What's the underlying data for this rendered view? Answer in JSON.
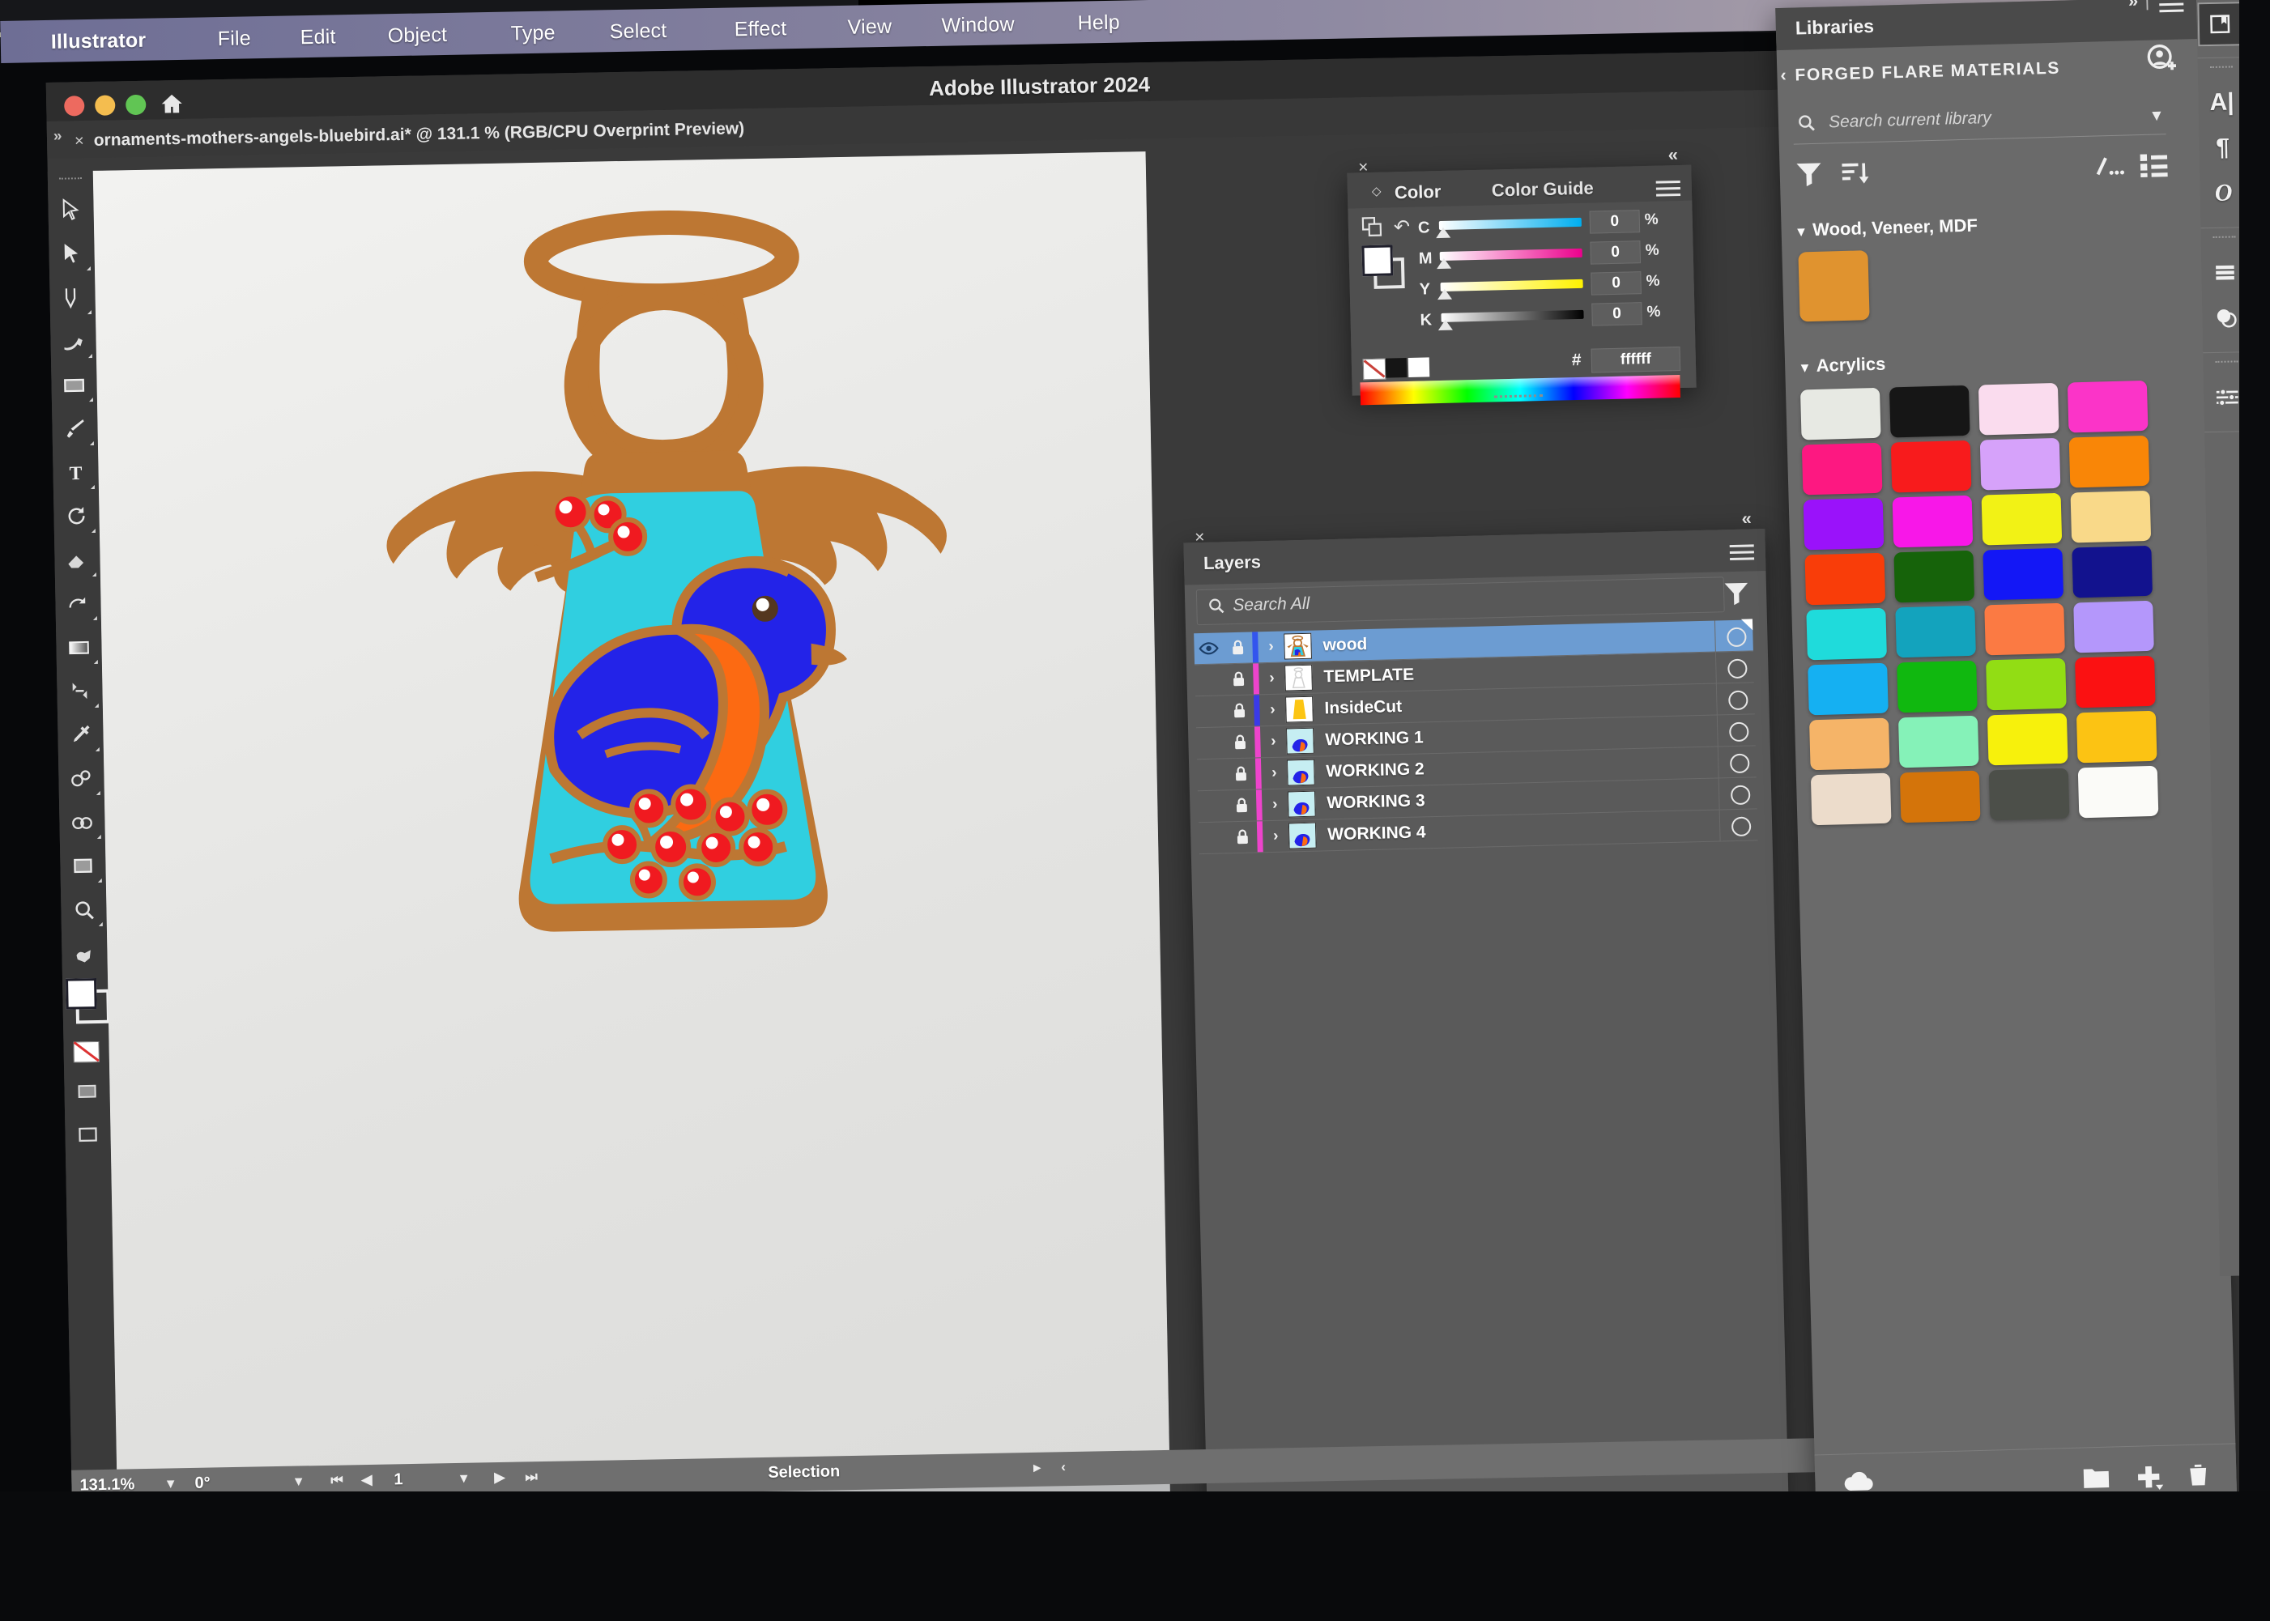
{
  "os_menu": {
    "items": [
      "Illustrator",
      "File",
      "Edit",
      "Object",
      "Type",
      "Select",
      "Effect",
      "View",
      "Window",
      "Help"
    ]
  },
  "app": {
    "title": "Adobe Illustrator 2024",
    "home_icon": "home-icon"
  },
  "document_tab": {
    "close_label": "×",
    "title": "ornaments-mothers-angels-bluebird.ai* @ 131.1 % (RGB/CPU Overprint Preview)"
  },
  "toolbar": {
    "tools": [
      {
        "name": "selection-tool",
        "glyph": "arrow"
      },
      {
        "name": "direct-selection-tool",
        "glyph": "arrow-filled"
      },
      {
        "name": "pen-tool",
        "glyph": "pen"
      },
      {
        "name": "curvature-tool",
        "glyph": "curvature"
      },
      {
        "name": "rectangle-tool",
        "glyph": "rect"
      },
      {
        "name": "paintbrush-tool",
        "glyph": "brush"
      },
      {
        "name": "type-tool",
        "glyph": "T"
      },
      {
        "name": "rotate-tool",
        "glyph": "rotate"
      },
      {
        "name": "eraser-tool",
        "glyph": "eraser"
      },
      {
        "name": "scale-tool",
        "glyph": "scale"
      },
      {
        "name": "gradient-tool",
        "glyph": "gradient"
      },
      {
        "name": "width-tool",
        "glyph": "width"
      },
      {
        "name": "eyedropper-tool",
        "glyph": "eyedropper"
      },
      {
        "name": "blend-tool",
        "glyph": "blend"
      },
      {
        "name": "shape-builder-tool",
        "glyph": "shapebuilder"
      },
      {
        "name": "artboard-tool",
        "glyph": "artboard"
      },
      {
        "name": "zoom-tool",
        "glyph": "zoom"
      },
      {
        "name": "hand-tool",
        "glyph": "hand"
      }
    ]
  },
  "color_panel": {
    "tabs": [
      {
        "label": "Color",
        "active": true
      },
      {
        "label": "Color Guide",
        "active": false
      }
    ],
    "sliders": [
      {
        "label": "C",
        "value": "0",
        "unit": "%",
        "track": "cyan"
      },
      {
        "label": "M",
        "value": "0",
        "unit": "%",
        "track": "magenta"
      },
      {
        "label": "Y",
        "value": "0",
        "unit": "%",
        "track": "yellow"
      },
      {
        "label": "K",
        "value": "0",
        "unit": "%",
        "track": "black"
      }
    ],
    "hex_symbol": "#",
    "hex_value": "ffffff",
    "fill_color": "#ffffff",
    "stroke_color": "#ffffff",
    "collapse_label": "«",
    "close_label": "×"
  },
  "layers_panel": {
    "tab_label": "Layers",
    "close_label": "×",
    "collapse_label": "«",
    "search_placeholder": "Search All",
    "search_value": "",
    "rows": [
      {
        "name": "wood",
        "visible": true,
        "locked": true,
        "selected": true,
        "color": "#3355ee",
        "thumb": "angel"
      },
      {
        "name": "TEMPLATE",
        "visible": false,
        "locked": true,
        "selected": false,
        "color": "#ee44cc",
        "thumb": "angel-faint"
      },
      {
        "name": "InsideCut",
        "visible": false,
        "locked": true,
        "selected": false,
        "color": "#3a3ae8",
        "thumb": "yellow"
      },
      {
        "name": "WORKING 1",
        "visible": false,
        "locked": true,
        "selected": false,
        "color": "#ee44cc",
        "thumb": "bird"
      },
      {
        "name": "WORKING 2",
        "visible": false,
        "locked": true,
        "selected": false,
        "color": "#ee44cc",
        "thumb": "bird"
      },
      {
        "name": "WORKING 3",
        "visible": false,
        "locked": true,
        "selected": false,
        "color": "#ee44cc",
        "thumb": "bird"
      },
      {
        "name": "WORKING 4",
        "visible": false,
        "locked": true,
        "selected": false,
        "color": "#ee44cc",
        "thumb": "bird"
      }
    ]
  },
  "libraries_panel": {
    "tab_label": "Libraries",
    "library_name": "FORGED FLARE MATERIALS",
    "back_label": "‹",
    "search_placeholder": "Search current library",
    "search_value": "",
    "overflow_label": "»",
    "groups": [
      {
        "title": "Wood, Veneer, MDF",
        "expanded": true,
        "swatches": [
          "#e0932f"
        ]
      },
      {
        "title": "Acrylics",
        "expanded": true,
        "swatches": [
          "#e7e9e3",
          "#161616",
          "#fadcee",
          "#fb34c8",
          "#fd1881",
          "#f81b1c",
          "#d6a2fa",
          "#f98607",
          "#9a12fa",
          "#f817e8",
          "#f2f215",
          "#f9d989",
          "#f93d09",
          "#16630a",
          "#1317f6",
          "#12128e",
          "#1fdbdb",
          "#13a3bd",
          "#fb7a43",
          "#b497fb",
          "#15b0f2",
          "#10b80f",
          "#92dd14",
          "#fb1112",
          "#f5b468",
          "#85f2b8",
          "#f7f10c",
          "#fcc313",
          "#ecdccb",
          "#d4740a",
          "#4c4f49",
          "#fbfbf8"
        ]
      }
    ],
    "footer_icons": [
      "cloud-icon",
      "new-folder-icon",
      "add-icon",
      "delete-icon"
    ]
  },
  "right_dock": {
    "items": [
      {
        "name": "libraries-icon",
        "glyph": "books",
        "active": true
      },
      {
        "name": "character-icon",
        "glyph": "A"
      },
      {
        "name": "paragraph-icon",
        "glyph": "¶"
      },
      {
        "name": "glyphs-icon",
        "glyph": "O"
      },
      {
        "name": "align-icon",
        "glyph": "lines"
      },
      {
        "name": "transparency-icon",
        "glyph": "circles"
      },
      {
        "name": "properties-icon",
        "glyph": "sliders"
      }
    ]
  },
  "status_bar": {
    "zoom": "131.1%",
    "rotation": "0°",
    "page": "1",
    "tool_status": "Selection",
    "first_label": "⏮",
    "prev_label": "◀",
    "next_label": "▶",
    "last_label": "⏭",
    "carat": "‹"
  },
  "artwork": {
    "name": "angel-ornament-bluebird",
    "colors": {
      "wood": "#bd7733",
      "wood_dark": "#a7662a",
      "sky": "#30cfe0",
      "bird_blue": "#2323e8",
      "bird_breast": "#fc6a12",
      "berry": "#f01a20",
      "berry_dot": "#ffffff",
      "eye": "#54371f"
    }
  }
}
